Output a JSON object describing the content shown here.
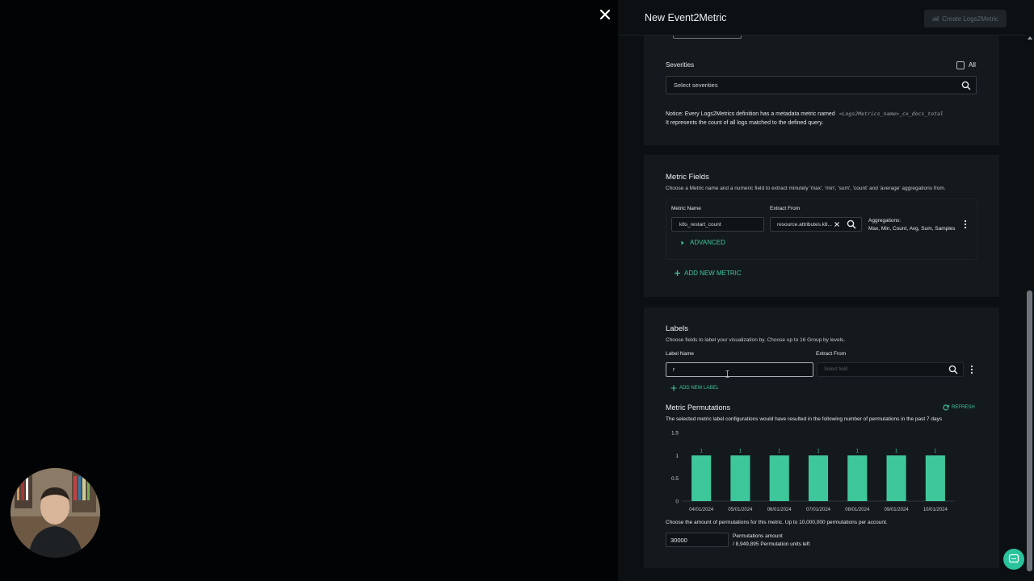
{
  "drawer": {
    "title": "New Event2Metric",
    "create_button": "Create Logs2Metric"
  },
  "severities": {
    "label": "Severities",
    "all_label": "All",
    "placeholder": "Select severities",
    "notice_prefix": "Notice: Every Logs2Metrics definition has a metadata metric named",
    "notice_code": "<Logs2Metrics_name>_cx_docs_total",
    "notice_line2": "It represents the count of all logs matched to the defined query."
  },
  "metric_fields": {
    "title": "Metric Fields",
    "description": "Choose a Metric name and a numeric field to extract minutely 'max', 'min', 'sum', 'count' and 'average' aggregations from.",
    "metric_name_label": "Metric Name",
    "metric_name_value": "k8s_restart_count",
    "extract_from_label": "Extract From",
    "extract_from_value": "resource.attributes.k8...",
    "aggregations_label": "Aggregations:",
    "aggregations_value": "Max, Min, Count, Avg, Sum, Samples",
    "advanced": "ADVANCED",
    "add_metric": "ADD NEW METRIC"
  },
  "labels": {
    "title": "Labels",
    "description": "Choose fields to label your visualization by. Choose up to 16 Group by levels.",
    "label_name_label": "Label Name",
    "label_name_value": "r",
    "extract_from_label": "Extract From",
    "extract_from_placeholder": "Select field",
    "add_label": "ADD NEW LABEL"
  },
  "permutations": {
    "title": "Metric Permutations",
    "refresh": "REFRESH",
    "description": "The selected metric label configurations would have resulted in the following number of permutations in the past 7 days",
    "amount_desc": "Choose the amount of permutations for this metric. Up to 10,000,000 permutations per account.",
    "amount_value": "30000",
    "amount_label": "Permutations amount",
    "units_left": "/ 8,949,895 Permutation units left"
  },
  "chart_data": {
    "type": "bar",
    "categories": [
      "04/01/2024",
      "05/01/2024",
      "06/01/2024",
      "07/01/2024",
      "08/01/2024",
      "09/01/2024",
      "10/01/2024"
    ],
    "values": [
      1,
      1,
      1,
      1,
      1,
      1,
      1
    ],
    "ylim": [
      0,
      1.5
    ],
    "yticks": [
      "1.5",
      "1",
      "0.5",
      "0"
    ],
    "bar_color": "#3ec79a",
    "title": "",
    "xlabel": "",
    "ylabel": ""
  },
  "colors": {
    "accent": "#3ec79a",
    "panel": "#14191d",
    "background": "#0c1013"
  },
  "icons": [
    "close-icon",
    "chart-icon",
    "search-icon",
    "clear-icon",
    "kebab-icon",
    "plus-icon",
    "refresh-icon",
    "chat-icon"
  ]
}
